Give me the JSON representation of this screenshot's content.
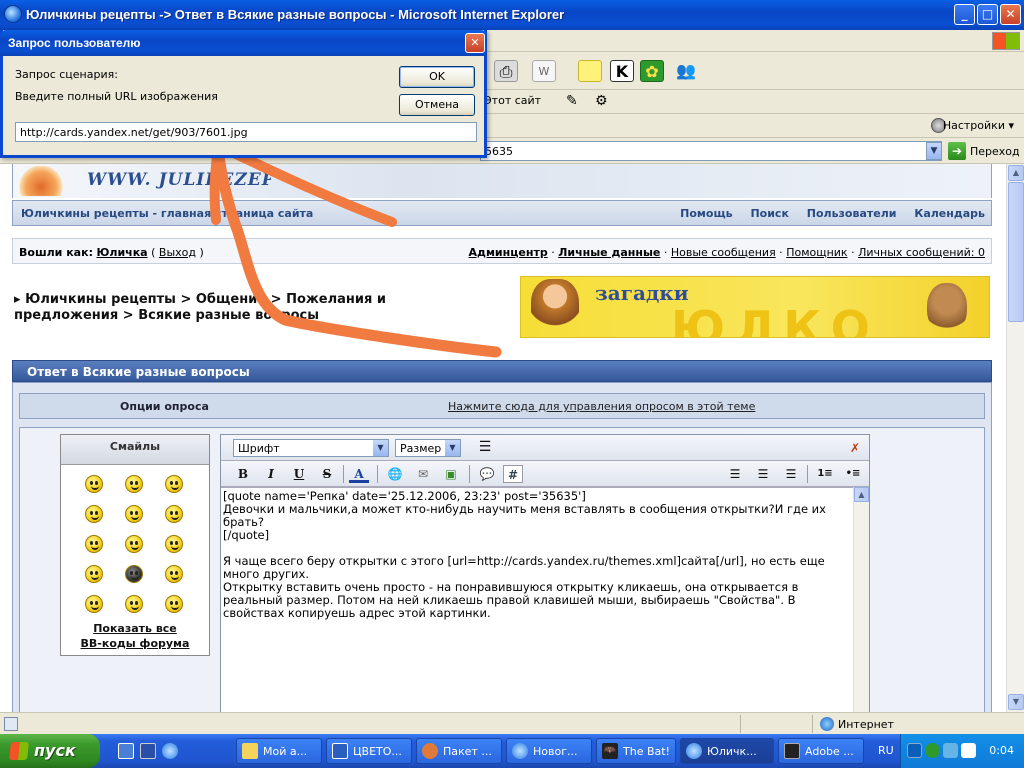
{
  "window": {
    "title": "Юличкины рецепты -> Ответ в Всякие разные вопросы - Microsoft Internet Explorer",
    "minimize": "_",
    "maximize": "□",
    "close": "✕"
  },
  "linkbar": {
    "site_button": "Этот сайт"
  },
  "settingsbar": {
    "settings_label": "Настройки"
  },
  "address": {
    "value": "5635",
    "go_label": "Переход"
  },
  "forum": {
    "site_name": "WWW. JULIREZEPT.NET",
    "nav_home": "Юличкины рецепты - главная страница сайта",
    "nav_links": [
      "Помощь",
      "Поиск",
      "Пользователи",
      "Календарь"
    ],
    "logged_in_prefix": "Вошли как:",
    "username": "Юличка",
    "logout": "Выход",
    "user_links": {
      "admin": "Админцентр",
      "personal": "Личные данные",
      "new_messages": "Новые сообщения",
      "helper": "Помощник",
      "private_messages": "Личных сообщений: 0"
    },
    "breadcrumb": [
      "Юличкины рецепты",
      "Общение",
      "Пожелания и предложения",
      "Всякие разные вопросы"
    ],
    "ad_text": "загадки",
    "ad_deco": "ЮЛКО",
    "reply_header": "Ответ в Всякие разные вопросы",
    "poll_options_label": "Опции опроса",
    "poll_manage_link": "Нажмите сюда для управления опросом в этой теме",
    "smilies_header": "Смайлы",
    "show_all": "Показать все",
    "bb_codes": "BB-коды форума"
  },
  "editor": {
    "font_select": "Шрифт",
    "size_select": "Размер",
    "bold": "B",
    "italic": "I",
    "underline": "U",
    "strike": "S",
    "text": "[quote name='Репка' date='25.12.2006, 23:23' post='35635']\nДевочки и мальчики,а может кто-нибудь научить меня вставлять в сообщения открытки?И где их брать?\n[/quote]\n\nЯ чаще всего беру открытки с этого [url=http://cards.yandex.ru/themes.xml]сайта[/url], но есть еще много других.\nОткрытку вставить очень просто - на понравившуюся открытку кликаешь, она открывается в реальный размер. Потом на ней кликаешь правой клавишей мыши, выбираешь \"Свойства\". В свойствах копируешь адрес этой картинки."
  },
  "dialog": {
    "title": "Запрос пользователю",
    "prompt": "Запрос сценария:",
    "message": "Введите полный URL изображения",
    "ok": "OK",
    "cancel": "Отмена",
    "input_value": "http://cards.yandex.net/get/903/7601.jpg"
  },
  "statusbar": {
    "zone": "Интернет"
  },
  "taskbar": {
    "start": "пуск",
    "tasks": [
      "Мой а...",
      "ЦВЕТО...",
      "Пакет ...",
      "Новог...",
      "The Bat!",
      "Юличк...",
      "Adobe ..."
    ],
    "lang": "RU",
    "clock": "0:04"
  },
  "colors": {
    "arrow": "#f07a40",
    "accent": "#0a4fd2"
  }
}
